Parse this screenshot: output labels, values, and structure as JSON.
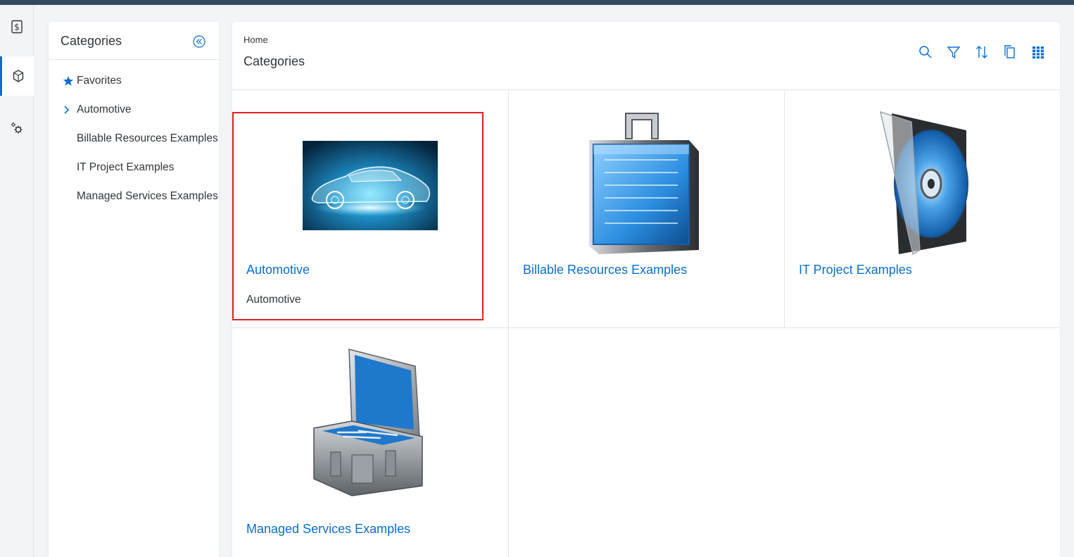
{
  "rail": {
    "items": [
      {
        "icon": "dollar-icon"
      },
      {
        "icon": "cube-icon",
        "active": true
      },
      {
        "icon": "gears-icon"
      }
    ]
  },
  "side": {
    "title": "Categories",
    "items": [
      {
        "label": "Favorites",
        "lead": "star-icon"
      },
      {
        "label": "Automotive",
        "lead": "chevron-right-icon"
      },
      {
        "label": "Billable Resources Examples",
        "lead": ""
      },
      {
        "label": "IT Project Examples",
        "lead": ""
      },
      {
        "label": "Managed Services Examples",
        "lead": ""
      }
    ]
  },
  "main": {
    "breadcrumb": "Home",
    "title": "Categories",
    "toolbar": [
      "search-icon",
      "filter-icon",
      "sort-icon",
      "copy-icon",
      "grid-view-icon"
    ],
    "tiles": [
      {
        "title": "Automotive",
        "description": "Automotive",
        "image": "car-hologram-image",
        "selected": true
      },
      {
        "title": "Billable Resources Examples",
        "description": "",
        "image": "briefcase-image"
      },
      {
        "title": "IT Project Examples",
        "description": "",
        "image": "cd-case-image"
      },
      {
        "title": "Managed Services Examples",
        "description": "",
        "image": "toolbox-image"
      }
    ]
  },
  "colors": {
    "accent": "#0a6ed1",
    "shell": "#354a5f",
    "selection": "#e02020"
  }
}
